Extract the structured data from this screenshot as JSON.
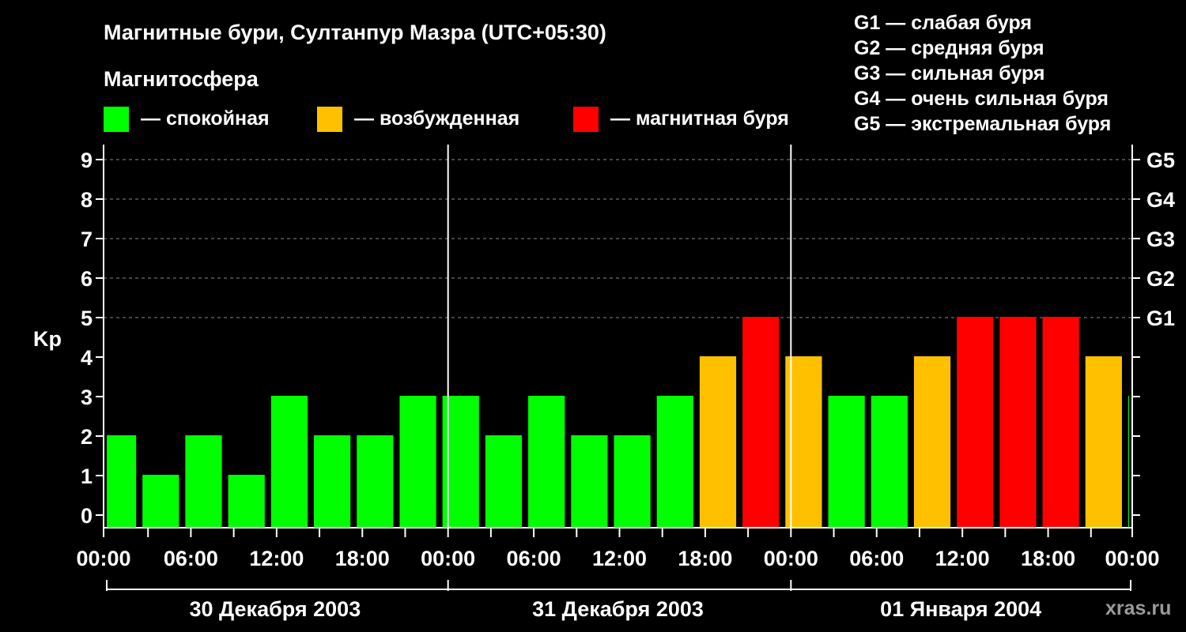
{
  "chart_data": {
    "type": "bar",
    "title": "Магнитные бури, Султанпур Мазра (UTC+05:30)",
    "legend": {
      "heading": "Магнитосфера",
      "items": [
        {
          "label": "— спокойная",
          "color": "#00ff00"
        },
        {
          "label": "— возбужденная",
          "color": "#ffc000"
        },
        {
          "label": "— магнитная буря",
          "color": "#ff0000"
        }
      ],
      "g_scale": [
        "G1 — слабая буря",
        "G2 — средняя буря",
        "G3 — сильная буря",
        "G4 — очень сильная буря",
        "G5 — экстремальная буря"
      ]
    },
    "ylabel": "Kp",
    "ylim": [
      0,
      9
    ],
    "y_ticks": [
      "0",
      "1",
      "2",
      "3",
      "4",
      "5",
      "6",
      "7",
      "8",
      "9"
    ],
    "g_ticks": [
      {
        "kp": 5,
        "label": "G1"
      },
      {
        "kp": 6,
        "label": "G2"
      },
      {
        "kp": 7,
        "label": "G3"
      },
      {
        "kp": 8,
        "label": "G4"
      },
      {
        "kp": 9,
        "label": "G5"
      }
    ],
    "x_ticks": [
      "00:00",
      "06:00",
      "12:00",
      "18:00",
      "00:00",
      "06:00",
      "12:00",
      "18:00",
      "00:00",
      "06:00",
      "12:00",
      "18:00",
      "00:00"
    ],
    "days": [
      "30 Декабря 2003",
      "31 Декабря 2003",
      "01 Января 2004"
    ],
    "bars": [
      {
        "start": "30 Декабря 2003 00:00",
        "end": "30 Декабря 2003 02:30",
        "kp": 2,
        "level": "quiet"
      },
      {
        "start": "30 Декабря 2003 02:30",
        "end": "30 Декабря 2003 05:30",
        "kp": 1,
        "level": "quiet"
      },
      {
        "start": "30 Декабря 2003 05:30",
        "end": "30 Декабря 2003 08:30",
        "kp": 2,
        "level": "quiet"
      },
      {
        "start": "30 Декабря 2003 08:30",
        "end": "30 Декабря 2003 11:30",
        "kp": 1,
        "level": "quiet"
      },
      {
        "start": "30 Декабря 2003 11:30",
        "end": "30 Декабря 2003 14:30",
        "kp": 3,
        "level": "quiet"
      },
      {
        "start": "30 Декабря 2003 14:30",
        "end": "30 Декабря 2003 17:30",
        "kp": 2,
        "level": "quiet"
      },
      {
        "start": "30 Декабря 2003 17:30",
        "end": "30 Декабря 2003 20:30",
        "kp": 2,
        "level": "quiet"
      },
      {
        "start": "30 Декабря 2003 20:30",
        "end": "30 Декабря 2003 23:30",
        "kp": 3,
        "level": "quiet"
      },
      {
        "start": "30 Декабря 2003 23:30",
        "end": "31 Декабря 2003 02:30",
        "kp": 3,
        "level": "quiet"
      },
      {
        "start": "31 Декабря 2003 02:30",
        "end": "31 Декабря 2003 05:30",
        "kp": 2,
        "level": "quiet"
      },
      {
        "start": "31 Декабря 2003 05:30",
        "end": "31 Декабря 2003 08:30",
        "kp": 3,
        "level": "quiet"
      },
      {
        "start": "31 Декабря 2003 08:30",
        "end": "31 Декабря 2003 11:30",
        "kp": 2,
        "level": "quiet"
      },
      {
        "start": "31 Декабря 2003 11:30",
        "end": "31 Декабря 2003 14:30",
        "kp": 2,
        "level": "quiet"
      },
      {
        "start": "31 Декабря 2003 14:30",
        "end": "31 Декабря 2003 17:30",
        "kp": 3,
        "level": "quiet"
      },
      {
        "start": "31 Декабря 2003 17:30",
        "end": "31 Декабря 2003 20:30",
        "kp": 4,
        "level": "active"
      },
      {
        "start": "31 Декабря 2003 20:30",
        "end": "31 Декабря 2003 23:30",
        "kp": 5,
        "level": "storm"
      },
      {
        "start": "31 Декабря 2003 23:30",
        "end": "01 Января 2004 02:30",
        "kp": 4,
        "level": "active"
      },
      {
        "start": "01 Января 2004 02:30",
        "end": "01 Января 2004 05:30",
        "kp": 3,
        "level": "quiet"
      },
      {
        "start": "01 Января 2004 05:30",
        "end": "01 Января 2004 08:30",
        "kp": 3,
        "level": "quiet"
      },
      {
        "start": "01 Января 2004 08:30",
        "end": "01 Января 2004 11:30",
        "kp": 4,
        "level": "active"
      },
      {
        "start": "01 Января 2004 11:30",
        "end": "01 Января 2004 14:30",
        "kp": 5,
        "level": "storm"
      },
      {
        "start": "01 Января 2004 14:30",
        "end": "01 Января 2004 17:30",
        "kp": 5,
        "level": "storm"
      },
      {
        "start": "01 Января 2004 17:30",
        "end": "01 Января 2004 20:30",
        "kp": 5,
        "level": "storm"
      },
      {
        "start": "01 Января 2004 20:30",
        "end": "01 Января 2004 23:30",
        "kp": 4,
        "level": "active"
      },
      {
        "start": "01 Января 2004 23:30",
        "end": "02 Января 2004 00:00",
        "kp": 3,
        "level": "quiet"
      }
    ],
    "colors": {
      "quiet": "#00ff00",
      "active": "#ffc000",
      "storm": "#ff0000"
    },
    "grid": true
  },
  "watermark": "xras.ru"
}
